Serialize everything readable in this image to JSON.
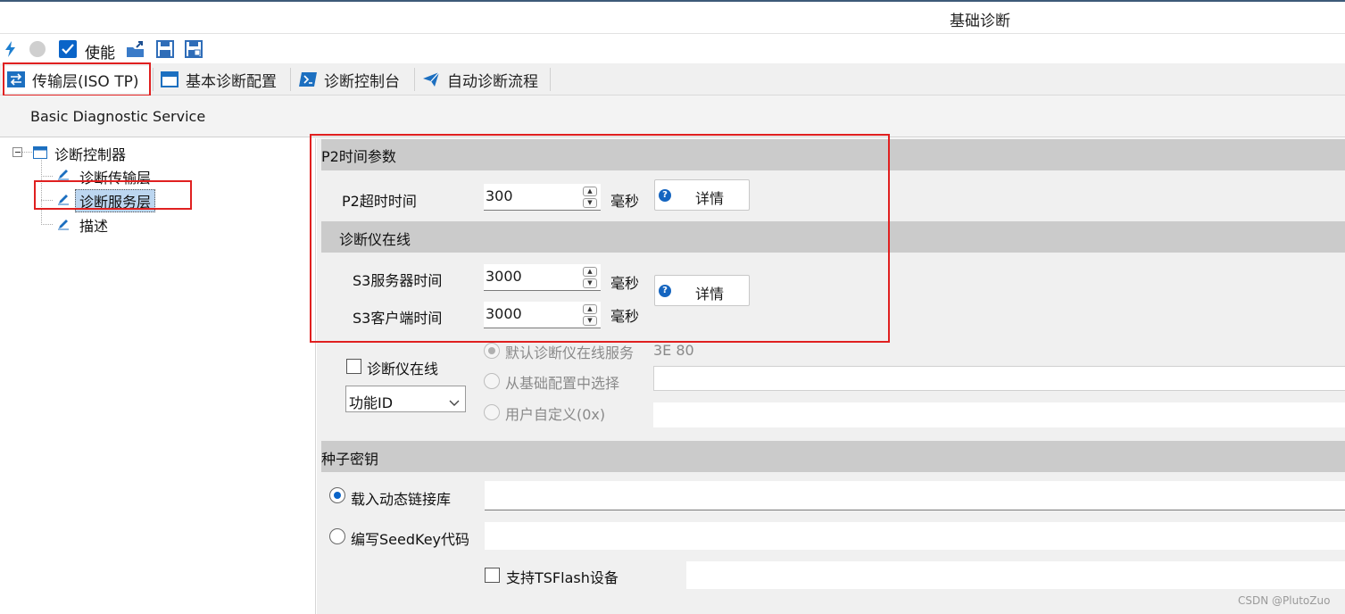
{
  "window": {
    "title": "基础诊断"
  },
  "toolbar": {
    "enable_label": "使能",
    "icons": [
      "lightning-icon",
      "record-icon",
      "enable-checkbox",
      "export-icon",
      "save-icon",
      "save-as-icon"
    ]
  },
  "tabs": [
    {
      "label": "传输层(ISO TP)",
      "icon": "transfer-icon",
      "active": true
    },
    {
      "label": "基本诊断配置",
      "icon": "window-icon"
    },
    {
      "label": "诊断控制台",
      "icon": "console-icon"
    },
    {
      "label": "自动诊断流程",
      "icon": "send-icon"
    }
  ],
  "service": {
    "title": "Basic Diagnostic Service"
  },
  "tree": {
    "root": "诊断控制器",
    "children": [
      "诊断传输层",
      "诊断服务层",
      "描述"
    ],
    "selected": "诊断服务层"
  },
  "p2": {
    "section": "P2时间参数",
    "timeout_label": "P2超时时间",
    "timeout_value": "300",
    "unit": "毫秒",
    "detail_label": "详情"
  },
  "tester": {
    "section": "诊断仪在线",
    "s3_server_label": "S3服务器时间",
    "s3_server_value": "3000",
    "s3_client_label": "S3客户端时间",
    "s3_client_value": "3000",
    "unit": "毫秒",
    "detail_label": "详情",
    "online_checkbox": "诊断仪在线",
    "id_select": "功能ID",
    "opt_default": "默认诊断仪在线服务",
    "opt_default_value": "3E 80",
    "opt_basic": "从基础配置中选择",
    "opt_custom": "用户自定义(0x)"
  },
  "seed": {
    "section": "种子密钥",
    "opt_dll": "载入动态链接库",
    "opt_code": "编写SeedKey代码",
    "tsflash": "支持TSFlash设备"
  },
  "watermark": "CSDN @PlutoZuo",
  "colors": {
    "accent": "#0a64c8",
    "highlight": "#e02020",
    "section_bg": "#cbcbcb"
  }
}
